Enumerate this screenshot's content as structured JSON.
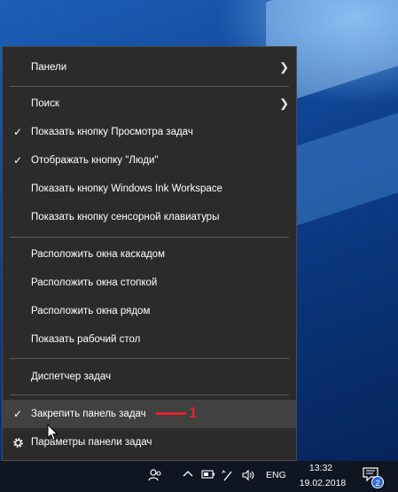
{
  "menu": {
    "items": [
      {
        "label": "Панели",
        "checked": false,
        "submenu": true
      },
      {
        "label": "Поиск",
        "checked": false,
        "submenu": true
      },
      {
        "label": "Показать кнопку Просмотра задач",
        "checked": true
      },
      {
        "label": "Отображать кнопку \"Люди\"",
        "checked": true
      },
      {
        "label": "Показать кнопку Windows Ink Workspace",
        "checked": false
      },
      {
        "label": "Показать кнопку сенсорной клавиатуры",
        "checked": false
      },
      {
        "label": "Расположить окна каскадом",
        "checked": false
      },
      {
        "label": "Расположить окна стопкой",
        "checked": false
      },
      {
        "label": "Расположить окна рядом",
        "checked": false
      },
      {
        "label": "Показать рабочий стол",
        "checked": false
      },
      {
        "label": "Диспетчер задач",
        "checked": false
      },
      {
        "label": "Закрепить панель задач",
        "checked": true,
        "highlighted": true
      },
      {
        "label": "Параметры панели задач",
        "icon": "gear-icon"
      }
    ],
    "check_glyph": "✓",
    "submenu_glyph": "❯"
  },
  "annotation": {
    "number": "1",
    "color": "#e0242a"
  },
  "taskbar": {
    "language": "ENG",
    "time": "13:32",
    "date": "19.02.2018",
    "notification_count": "2",
    "tray_icons": [
      "people-icon",
      "chevron-up-icon",
      "battery-icon",
      "pen-icon",
      "wifi-icon",
      "volume-icon",
      "action-center-icon"
    ]
  },
  "colors": {
    "menu_bg": "#2b2b2b",
    "highlight": "#414141",
    "taskbar": "#101522",
    "accent": "#2c6ed6"
  }
}
